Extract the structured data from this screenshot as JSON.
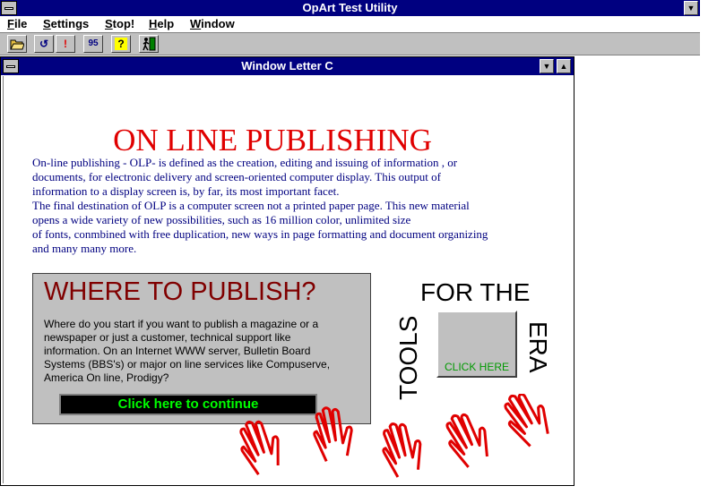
{
  "app": {
    "title": "OpArt Test Utility"
  },
  "menu": {
    "items": [
      {
        "label": "File",
        "key": "F",
        "rest": "ile"
      },
      {
        "label": "Settings",
        "key": "S",
        "rest": "ettings"
      },
      {
        "label": "Stop!",
        "key": "S",
        "rest": "top!"
      },
      {
        "label": "Help",
        "key": "H",
        "rest": "elp"
      },
      {
        "label": "Window",
        "key": "W",
        "rest": "indow"
      }
    ]
  },
  "toolbar": {
    "buttons": [
      "open-folder-icon",
      "refresh-icon",
      "alert-icon",
      "version-icon",
      "help-icon",
      "exit-icon"
    ],
    "version_label": "95",
    "help_label": "?",
    "alert_label": "!",
    "refresh_label": "↺"
  },
  "child_window": {
    "title": "Window Letter C",
    "heading": "ON LINE PUBLISHING",
    "paragraph": [
      "On-line publishing - OLP- is defined as the creation, editing and issuing  of  information , or",
      "documents,  for electronic delivery and screen-oriented computer display. This output of",
      "information to a display screen is, by far, its most important facet.",
      "The final destination of  OLP is a computer screen  not a  printed paper page. This new material",
      "opens a wide variety of new possibilities, such as 16 million color, unlimited size",
      "of fonts, conmbined with free duplication, new ways in page formatting and document organizing",
      "and many many more."
    ],
    "panel": {
      "title": "WHERE TO PUBLISH?",
      "text": [
        "Where do you start if  you want to publish a magazine or a",
        "newspaper or just a customer, technical support like",
        "information. On an   Internet WWW server, Bulletin Board",
        "Systems (BBS's) or major on line services like Compuserve,",
        "America On line, Prodigy?"
      ],
      "button_label": "Click here to continue"
    },
    "tools": {
      "top": "FOR THE",
      "left": "TOOLS",
      "right": "ERA",
      "button_label": "CLICK HERE"
    }
  },
  "colors": {
    "title_bar": "#000080",
    "heading": "#e00000",
    "paragraph": "#000080",
    "panel_title": "#800000",
    "continue_text": "#00ff00",
    "click_here_text": "#009900",
    "hands": "#e00000"
  }
}
